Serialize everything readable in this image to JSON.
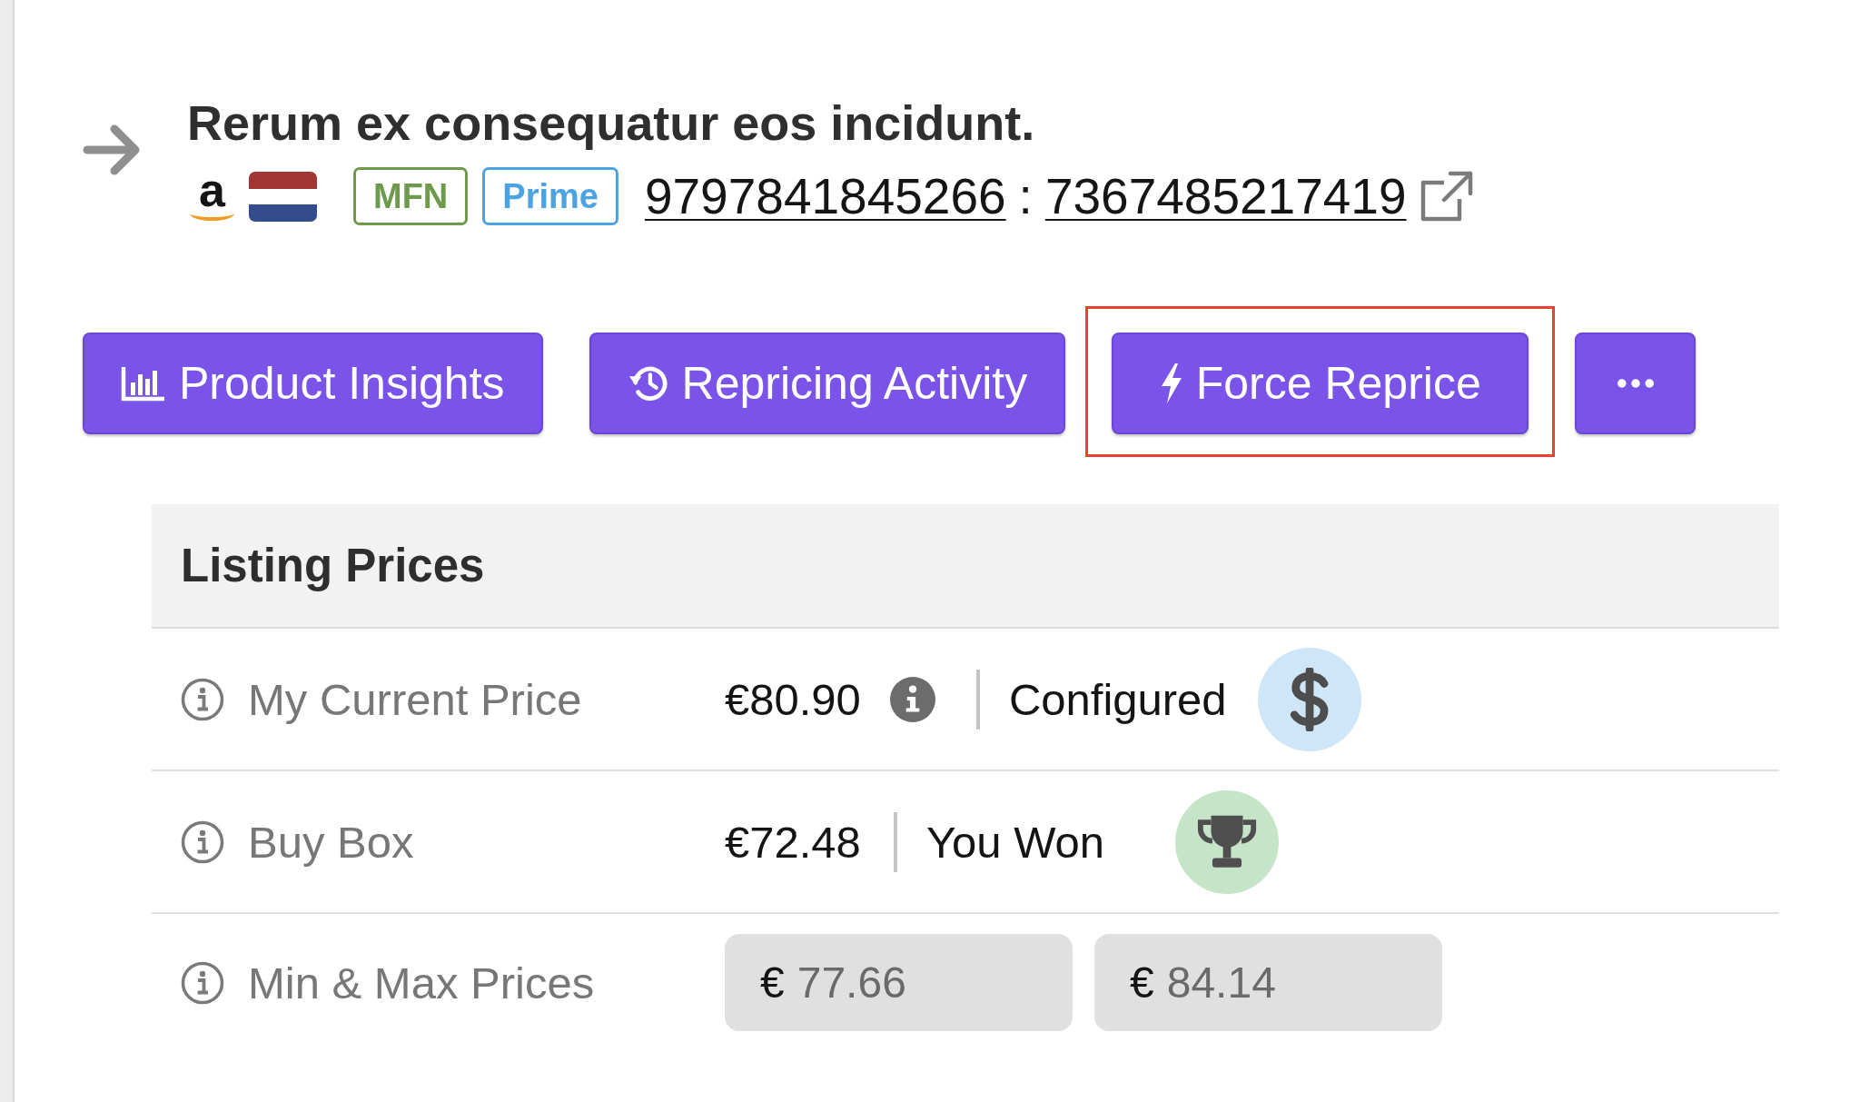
{
  "product": {
    "title": "Rerum ex consequatur eos incidunt.",
    "store_logo": "a",
    "tags": [
      {
        "label": "MFN",
        "color": "#6e9a4c"
      },
      {
        "label": "Prime",
        "color": "#4ca3e2"
      }
    ],
    "identifiers": [
      "9797841845266",
      "7367485217419"
    ],
    "identifier_separator": ":"
  },
  "actions": [
    {
      "label": "Product Insights",
      "highlighted": false
    },
    {
      "label": "Repricing Activity",
      "highlighted": false
    },
    {
      "label": "Force Reprice",
      "highlighted": true
    }
  ],
  "listing_prices": {
    "title": "Listing Prices",
    "rows": [
      {
        "kind": "current",
        "label": "My Current Price",
        "value": "€80.90",
        "status": "Configured",
        "color": "#cfe5f8"
      },
      {
        "kind": "buybox",
        "label": "Buy Box",
        "value": "€72.48",
        "status": "You Won",
        "color": "#c6e5c8"
      },
      {
        "kind": "range",
        "label": "Min & Max Prices",
        "fields": [
          {
            "prefix": "€",
            "value": "77.66",
            "disabled": true
          },
          {
            "prefix": "€",
            "value": "84.14",
            "disabled": true
          }
        ]
      }
    ]
  }
}
